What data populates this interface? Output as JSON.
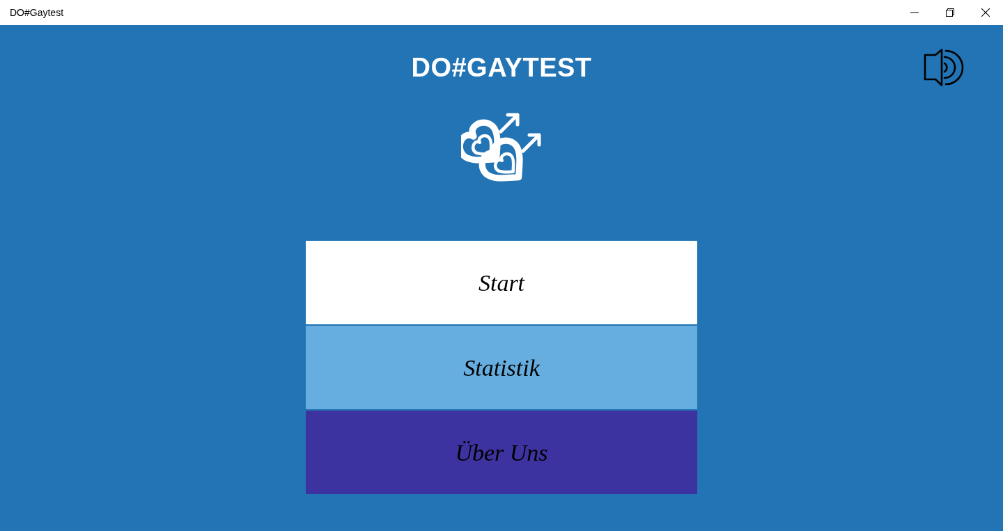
{
  "window": {
    "title": "DO#Gaytest"
  },
  "header": {
    "title": "DO#GAYTEST"
  },
  "menu": [
    {
      "label": "Start",
      "color": "#ffffff"
    },
    {
      "label": "Statistik",
      "color": "#67aee0"
    },
    {
      "label": "Über Uns",
      "color": "#3d33a0"
    }
  ]
}
